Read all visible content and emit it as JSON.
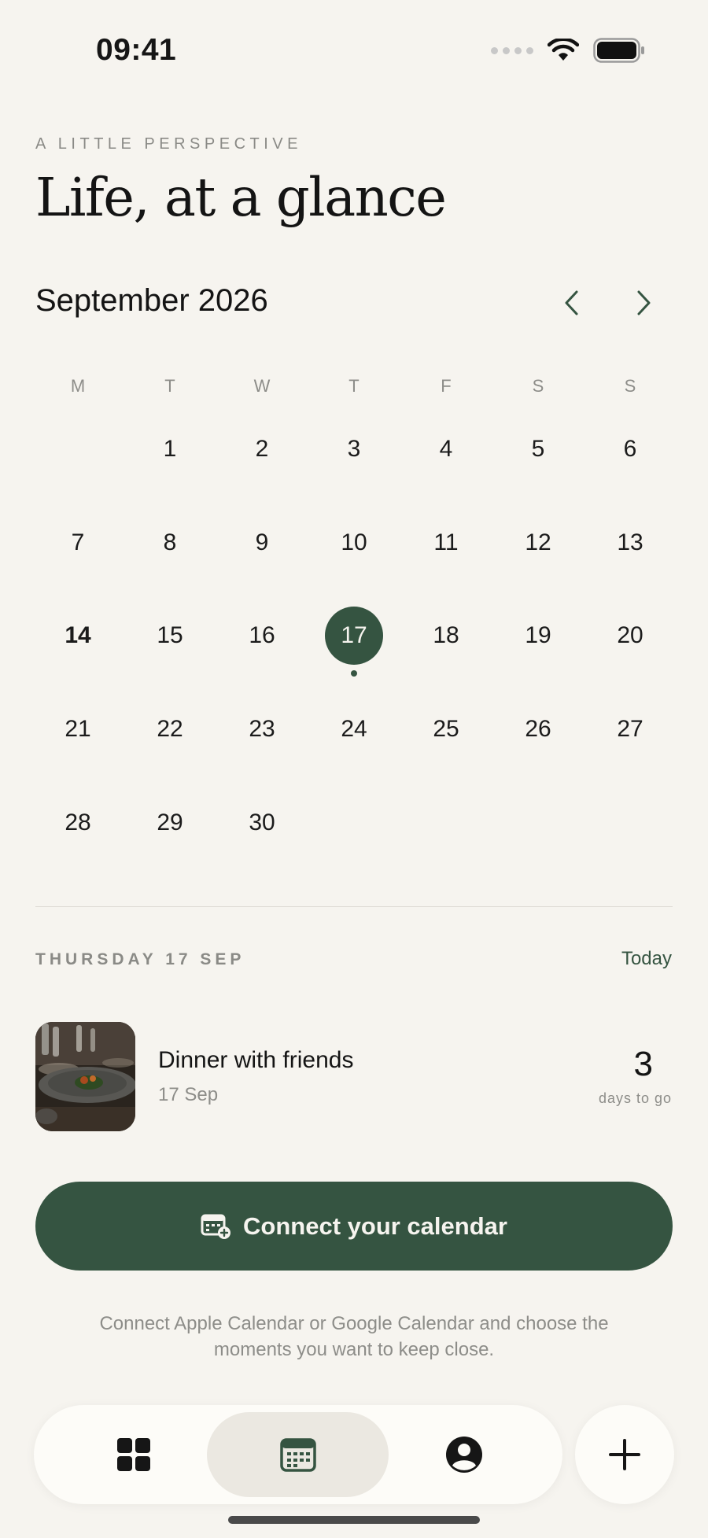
{
  "status_bar": {
    "time": "09:41"
  },
  "header": {
    "eyebrow": "A LITTLE PERSPECTIVE",
    "title": "Life, at a glance"
  },
  "calendar": {
    "month_label": "September 2026",
    "weekdays": [
      "M",
      "T",
      "W",
      "T",
      "F",
      "S",
      "S"
    ],
    "weeks": [
      [
        "",
        "1",
        "2",
        "3",
        "4",
        "5",
        "6"
      ],
      [
        "7",
        "8",
        "9",
        "10",
        "11",
        "12",
        "13"
      ],
      [
        "14",
        "15",
        "16",
        "17",
        "18",
        "19",
        "20"
      ],
      [
        "21",
        "22",
        "23",
        "24",
        "25",
        "26",
        "27"
      ],
      [
        "28",
        "29",
        "30",
        "",
        "",
        "",
        ""
      ]
    ],
    "bold_day": "14",
    "selected_day": "17"
  },
  "selected_day_section": {
    "label": "THURSDAY 17 SEP",
    "today_link": "Today"
  },
  "event": {
    "title": "Dinner with friends",
    "date": "17 Sep",
    "countdown_value": "3",
    "countdown_label": "days to go"
  },
  "connect": {
    "button_label": "Connect your calendar",
    "helper_text": "Connect Apple Calendar or Google Calendar and choose the moments you want to keep close."
  },
  "colors": {
    "background": "#f6f4ef",
    "accent": "#355441",
    "muted_text": "#8d8d89"
  },
  "icons": {
    "nav_prev": "chevron-left-icon",
    "nav_next": "chevron-right-icon",
    "tab_home": "grid-icon",
    "tab_calendar": "calendar-icon",
    "tab_profile": "user-circle-icon",
    "fab": "plus-icon"
  }
}
